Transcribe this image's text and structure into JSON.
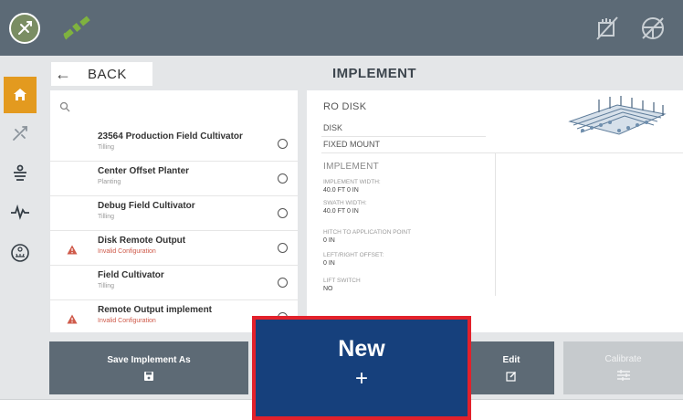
{
  "header": {
    "back_label": "BACK",
    "title": "IMPLEMENT"
  },
  "topbar_icons": [
    "guidance-circle-icon",
    "satellite-icon",
    "implement-icon",
    "steering-wheel-icon"
  ],
  "left_nav": [
    "home-icon",
    "guidance-icon",
    "field-layers-icon",
    "diagnostics-pulse-icon",
    "uft-icon"
  ],
  "implements": [
    {
      "name": "23564 Production Field Cultivator",
      "sub": "Tilling",
      "warning": false
    },
    {
      "name": "Center Offset Planter",
      "sub": "Planting",
      "warning": false
    },
    {
      "name": "Debug Field Cultivator",
      "sub": "Tilling",
      "warning": false
    },
    {
      "name": "Disk Remote Output",
      "sub": "Invalid Configuration",
      "warning": true
    },
    {
      "name": "Field Cultivator",
      "sub": "Tilling",
      "warning": false
    },
    {
      "name": "Remote Output implement",
      "sub": "Invalid Configuration",
      "warning": true
    }
  ],
  "detail": {
    "name": "RO DISK",
    "type": "DISK",
    "mount": "FIXED MOUNT",
    "section_title": "IMPLEMENT",
    "fields": [
      {
        "label": "IMPLEMENT WIDTH:",
        "value": "40.0 FT 0 IN"
      },
      {
        "label": "SWATH WIDTH:",
        "value": "40.0 FT 0 IN"
      },
      {
        "label": "HITCH TO APPLICATION POINT",
        "value": "0 IN"
      },
      {
        "label": "LEFT/RIGHT OFFSET:",
        "value": "0 IN"
      },
      {
        "label": "LIFT SWITCH",
        "value": "NO"
      }
    ]
  },
  "buttons": {
    "save_label": "Save Implement As",
    "new_label": "New",
    "new_plus": "+",
    "edit_label": "Edit",
    "calibrate_label": "Calibrate"
  },
  "colors": {
    "topbar": "#5c6a76",
    "home_accent": "#e39a1f",
    "new_button": "#16407c",
    "highlight_border": "#e2212b",
    "warning": "#cf5a4a"
  }
}
